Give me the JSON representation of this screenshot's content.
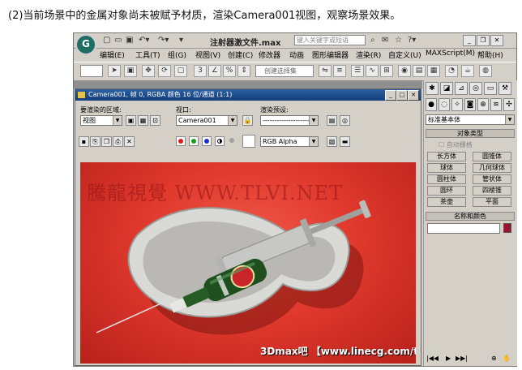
{
  "caption": "(2)当前场景中的金属对象尚未被赋予材质，渲染Camera001视图，观察场景效果。",
  "app": {
    "file_title": "注射器激文件.max",
    "search_placeholder": "键入关键字或短语",
    "quick_access_icons": [
      "new-icon",
      "open-icon",
      "save-icon",
      "undo-icon",
      "redo-icon"
    ],
    "window_controls": [
      "minimize-icon",
      "restore-icon",
      "close-icon"
    ],
    "menus": [
      "编辑(E)",
      "工具(T)",
      "组(G)",
      "视图(V)",
      "创建(C)",
      "修改器",
      "动画",
      "图形编辑器",
      "渲染(R)",
      "自定义(U)",
      "MAXScript(M)",
      "帮助(H)"
    ]
  },
  "toolbar": {
    "filter_value": "",
    "selection_set_placeholder": "创建选择集"
  },
  "render_dialog": {
    "title": "Camera001, 帧 0, RGBA 颜色 16 位/通道 (1:1)",
    "area_label": "要渲染的区域:",
    "area_value": "视图",
    "viewport_label": "视口:",
    "viewport_value": "Camera001",
    "preset_label": "渲染预设:",
    "preset_value": "--------------------",
    "channel_value": "RGB Alpha",
    "channel_colors": [
      "#e01818",
      "#18a018",
      "#1830d8"
    ],
    "watermark_text": "騰龍視覺 WWW.TLVI.NET",
    "bottom_watermark": "3Dmax吧 【www.linecg.com/tieba/171】"
  },
  "command_panel": {
    "category_value": "标准基本体",
    "object_type_title": "对象类型",
    "autogrid_label": "自动栅格",
    "object_buttons": [
      "长方体",
      "圆锥体",
      "球体",
      "几何球体",
      "圆柱体",
      "管状体",
      "圆环",
      "四棱锥",
      "茶壶",
      "平面"
    ],
    "name_color_title": "名称和颜色",
    "object_color": "#9c1030"
  },
  "colors": {
    "render_background": "#e0392d",
    "bottle_green": "#1f4f1f",
    "label_red": "#c8242a"
  }
}
